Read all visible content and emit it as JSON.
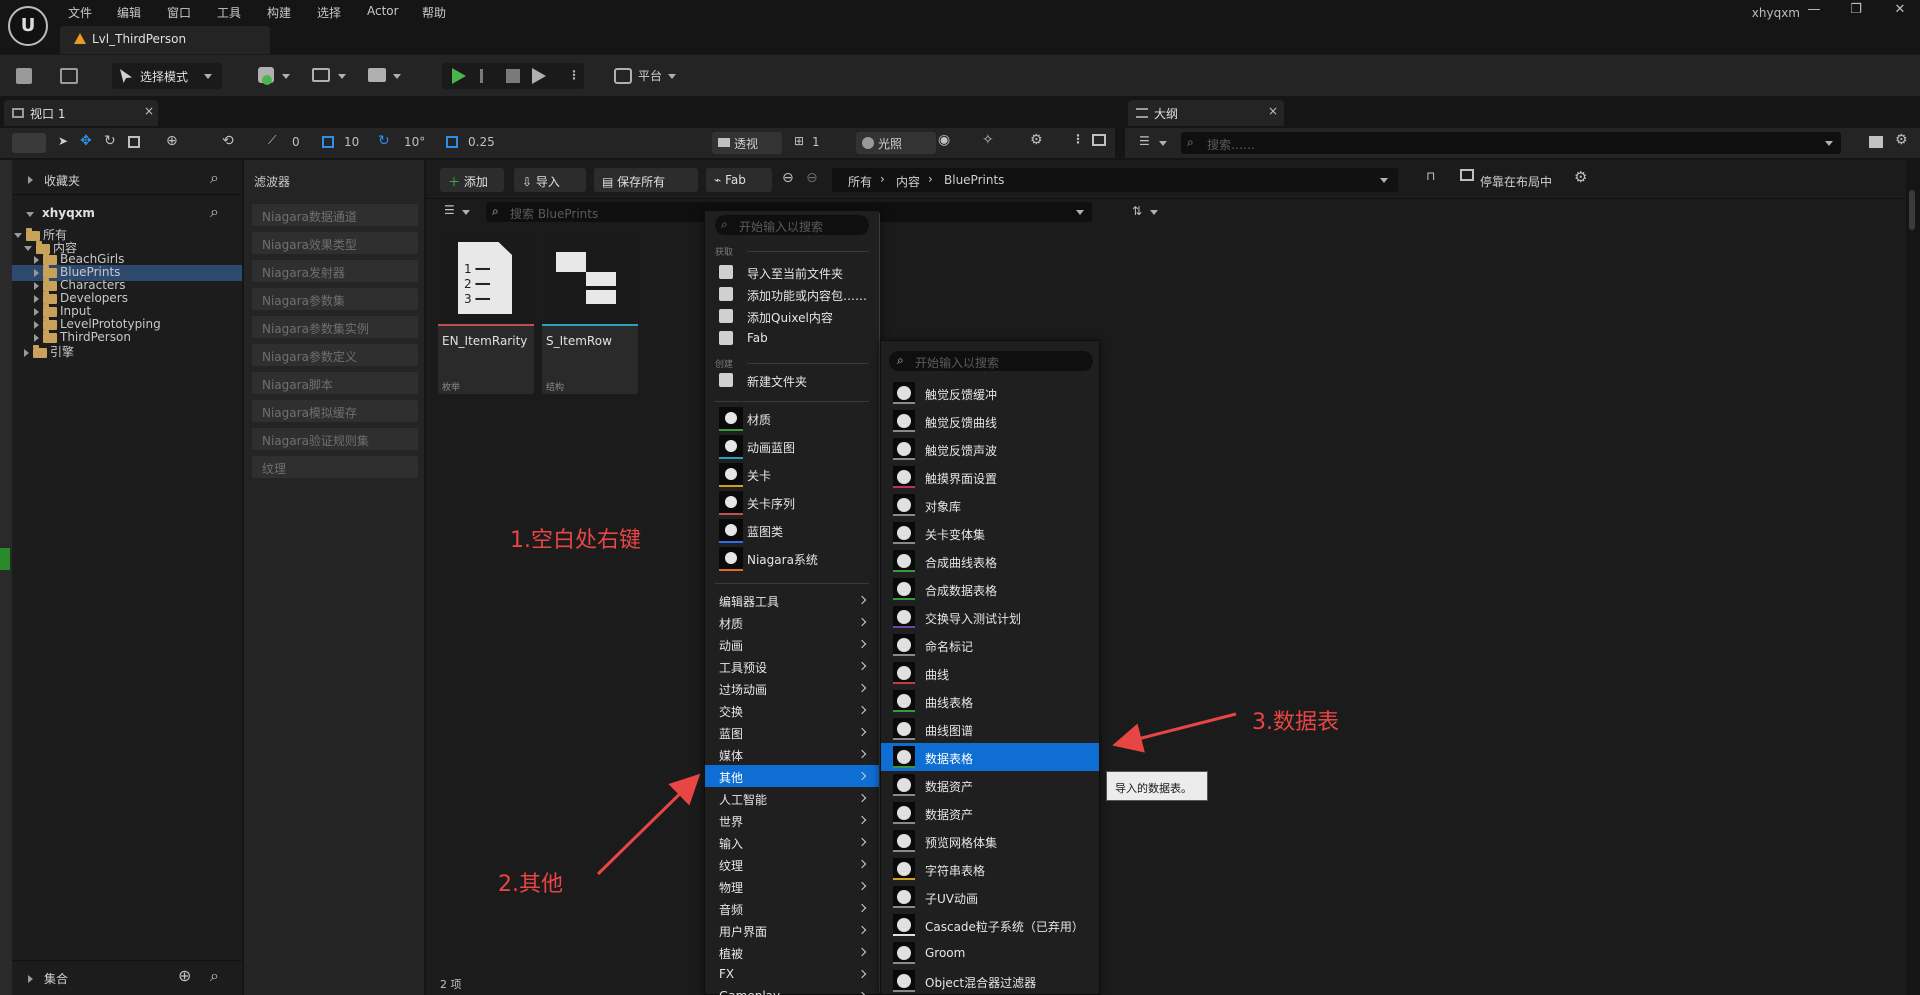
{
  "menu": {
    "items": [
      "文件",
      "编辑",
      "窗口",
      "工具",
      "构建",
      "选择",
      "Actor",
      "帮助"
    ]
  },
  "user": "xhyqxm",
  "level_tab": "Lvl_ThirdPerson",
  "toolbar": {
    "mode_label": "选择模式",
    "platform_label": "平台"
  },
  "tabs": {
    "viewport": "视口 1",
    "outliner": "大纲"
  },
  "viewport_toolbar": {
    "rotate_val": "0",
    "grid_val": "10",
    "angle_val": "10°",
    "scale_val": "0.25",
    "perspective": "透视",
    "lighting": "光照",
    "level": "1"
  },
  "outliner": {
    "search_placeholder": "搜索……"
  },
  "sources": {
    "favorites": "收藏夹",
    "project": "xhyqxm",
    "tree": [
      {
        "label": "所有",
        "indent": 0,
        "open": true
      },
      {
        "label": "内容",
        "indent": 1,
        "open": true
      },
      {
        "label": "BeachGirls",
        "indent": 2
      },
      {
        "label": "BluePrints",
        "indent": 2,
        "selected": true
      },
      {
        "label": "Characters",
        "indent": 2
      },
      {
        "label": "Developers",
        "indent": 2
      },
      {
        "label": "Input",
        "indent": 2
      },
      {
        "label": "LevelPrototyping",
        "indent": 2
      },
      {
        "label": "ThirdPerson",
        "indent": 2
      },
      {
        "label": "引擎",
        "indent": 1
      }
    ],
    "collections": "集合"
  },
  "filters": {
    "title": "滤波器",
    "items": [
      "Niagara数据通道",
      "Niagara效果类型",
      "Niagara发射器",
      "Niagara参数集",
      "Niagara参数集实例",
      "Niagara参数定义",
      "Niagara脚本",
      "Niagara模拟缓存",
      "Niagara验证规则集",
      "纹理"
    ]
  },
  "content": {
    "add": "添加",
    "import": "导入",
    "save_all": "保存所有",
    "fab": "Fab",
    "breadcrumb": [
      "所有",
      "内容",
      "BluePrints"
    ],
    "dock_label": "停靠在布局中",
    "search_placeholder": "搜索 BluePrints",
    "assets": [
      {
        "name": "EN_ItemRarity",
        "type": "枚举"
      },
      {
        "name": "S_ItemRow",
        "type": "结构"
      }
    ],
    "count": "2 项"
  },
  "context_menu": {
    "search_placeholder": "开始输入以搜索",
    "section_get": "获取",
    "get_items": [
      "导入至当前文件夹",
      "添加功能或内容包……",
      "添加Quixel内容",
      "Fab"
    ],
    "section_create": "创建",
    "new_folder": "新建文件夹",
    "create_items": [
      "材质",
      "动画蓝图",
      "关卡",
      "关卡序列",
      "蓝图类",
      "Niagara系统"
    ],
    "categories": [
      "编辑器工具",
      "材质",
      "动画",
      "工具预设",
      "过场动画",
      "交换",
      "蓝图",
      "媒体",
      "其他",
      "人工智能",
      "世界",
      "输入",
      "纹理",
      "物理",
      "音频",
      "用户界面",
      "植被",
      "FX",
      "Gameplay"
    ],
    "selected_category": "其他"
  },
  "submenu": {
    "search_placeholder": "开始输入以搜索",
    "items": [
      "触觉反馈缓冲",
      "触觉反馈曲线",
      "触觉反馈声波",
      "触摸界面设置",
      "对象库",
      "关卡变体集",
      "合成曲线表格",
      "合成数据表格",
      "交换导入测试计划",
      "命名标记",
      "曲线",
      "曲线表格",
      "曲线图谱",
      "数据表格",
      "数据资产",
      "数据资产",
      "预览网格体集",
      "字符串表格",
      "子UV动画",
      "Cascade粒子系统（已弃用）",
      "Groom",
      "Object混合器过滤器"
    ],
    "selected": "数据表格",
    "underline_colors": [
      "#8a8a8a",
      "#8a8a8a",
      "#8a8a8a",
      "#c03060",
      "#8a8a8a",
      "#8a8a8a",
      "#3a9a3a",
      "#3a9a3a",
      "#6a4aa0",
      "#8a8a8a",
      "#c04040",
      "#3a9a3a",
      "#8a8a8a",
      "#3a9a3a",
      "#8a8a8a",
      "#8a8a8a",
      "#8a8a8a",
      "#d0a020",
      "#8a8a8a",
      "#e0e0e0",
      "#8a8a8a",
      "#8a8a8a"
    ]
  },
  "tooltip": "导入的数据表。",
  "annotations": {
    "step1": "1.空白处右键",
    "step2": "2.其他",
    "step3": "3.数据表"
  },
  "colors": {
    "accent": "#0e6ed4",
    "annotation": "#e84545",
    "play": "#4ab54a"
  }
}
